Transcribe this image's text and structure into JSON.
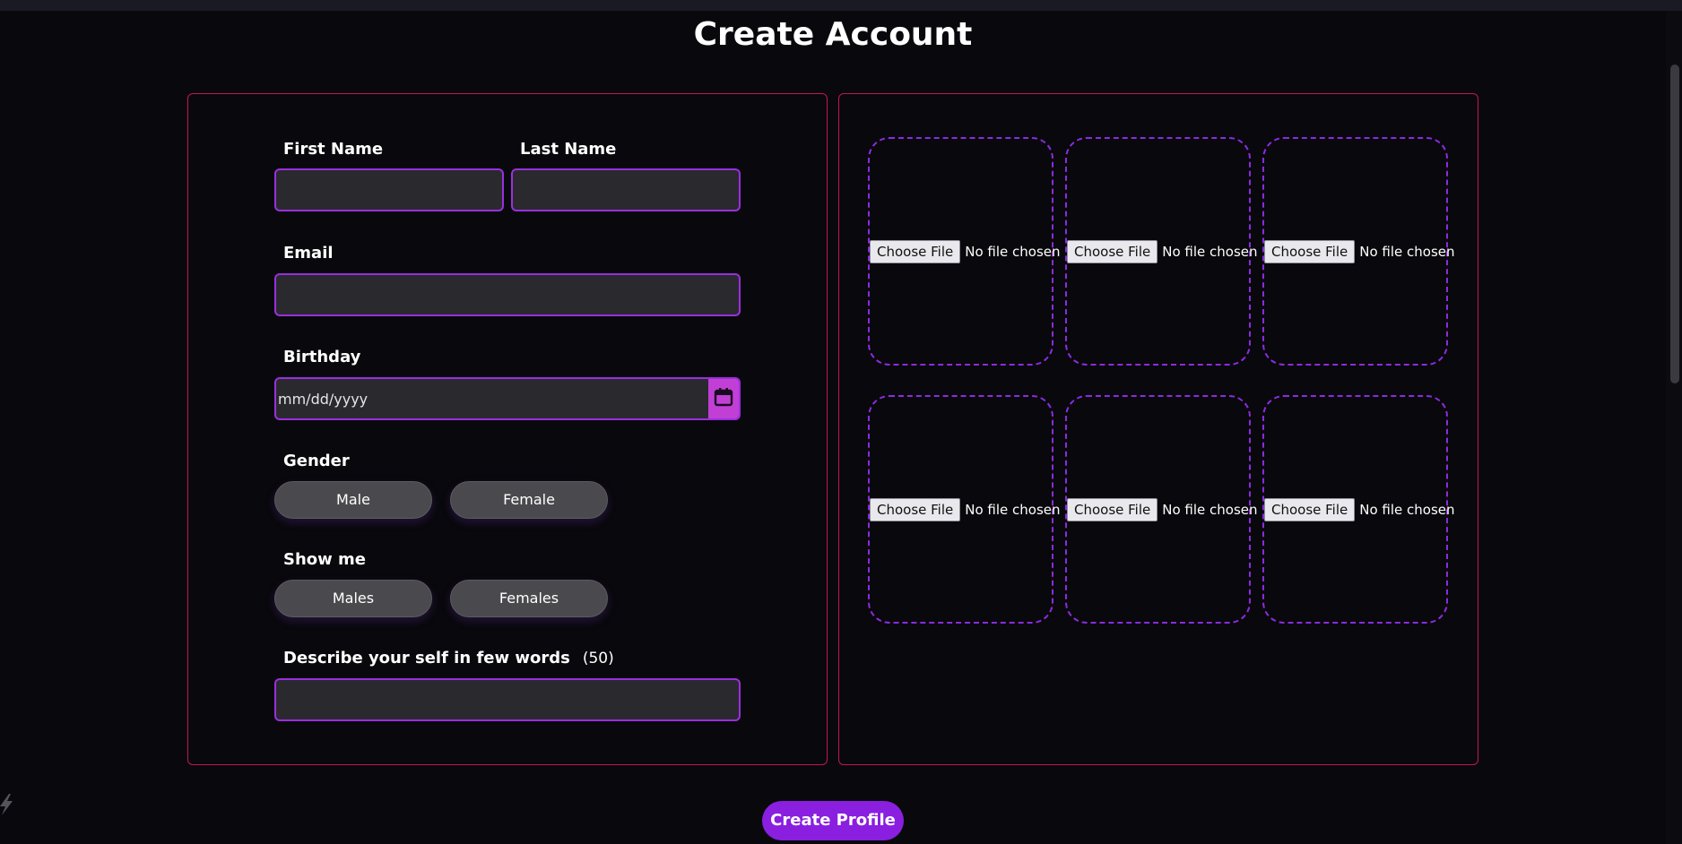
{
  "page": {
    "title": "Create Account"
  },
  "form": {
    "first_name_label": "First Name",
    "last_name_label": "Last Name",
    "email_label": "Email",
    "birthday_label": "Birthday",
    "birthday_placeholder": "mm/dd/yyyy",
    "gender_label": "Gender",
    "gender_options": [
      "Male",
      "Female"
    ],
    "show_me_label": "Show me",
    "show_me_options": [
      "Males",
      "Females"
    ],
    "describe_label": "Describe your self in few words",
    "describe_count": "(50)",
    "first_name_value": "",
    "last_name_value": "",
    "email_value": "",
    "describe_value": ""
  },
  "uploads": {
    "choose_label": "Choose File",
    "status_text": "No file chosen",
    "slots": 6
  },
  "actions": {
    "create_profile": "Create Profile"
  },
  "colors": {
    "background": "#09080c",
    "panel_border": "#c2184f",
    "input_border": "#9b2ee0",
    "accent": "#8a1fe0",
    "date_button": "#c23fd6"
  }
}
